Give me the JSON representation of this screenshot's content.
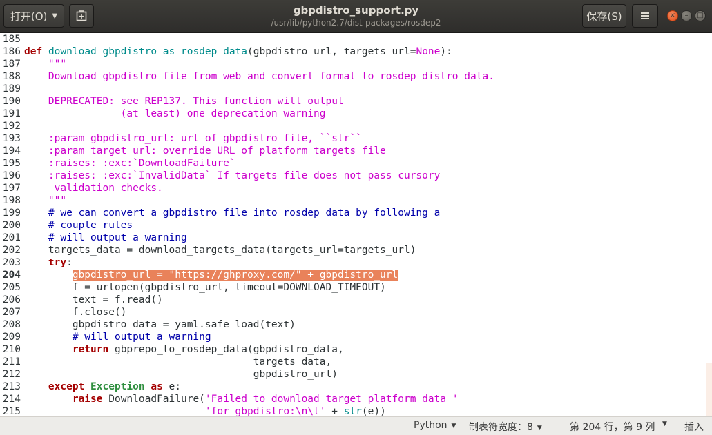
{
  "header": {
    "open_label": "打开(O)",
    "save_label": "保存(S)",
    "title": "gbpdistro_support.py",
    "subtitle": "/usr/lib/python2.7/dist-packages/rosdep2"
  },
  "editor": {
    "current_line": 204,
    "lines": [
      {
        "n": 185,
        "t": [
          {
            "c": "txt",
            "s": ""
          }
        ]
      },
      {
        "n": 186,
        "t": [
          {
            "c": "kw",
            "s": "def"
          },
          {
            "c": "txt",
            "s": " "
          },
          {
            "c": "fn",
            "s": "download_gbpdistro_as_rosdep_data"
          },
          {
            "c": "txt",
            "s": "(gbpdistro_url, targets_url="
          },
          {
            "c": "cst",
            "s": "None"
          },
          {
            "c": "txt",
            "s": "):"
          }
        ]
      },
      {
        "n": 187,
        "t": [
          {
            "c": "txt",
            "s": "    "
          },
          {
            "c": "doc",
            "s": "\"\"\""
          }
        ]
      },
      {
        "n": 188,
        "t": [
          {
            "c": "doc",
            "s": "    Download gbpdistro file from web and convert format to rosdep distro data."
          }
        ]
      },
      {
        "n": 189,
        "t": [
          {
            "c": "txt",
            "s": ""
          }
        ]
      },
      {
        "n": 190,
        "t": [
          {
            "c": "doc",
            "s": "    DEPRECATED: see REP137. This function will output"
          }
        ]
      },
      {
        "n": 191,
        "t": [
          {
            "c": "doc",
            "s": "                (at least) one deprecation warning"
          }
        ]
      },
      {
        "n": 192,
        "t": [
          {
            "c": "txt",
            "s": ""
          }
        ]
      },
      {
        "n": 193,
        "t": [
          {
            "c": "doc",
            "s": "    :param gbpdistro_url: url of gbpdistro file, ``str``"
          }
        ]
      },
      {
        "n": 194,
        "t": [
          {
            "c": "doc",
            "s": "    :param target_url: override URL of platform targets file"
          }
        ]
      },
      {
        "n": 195,
        "t": [
          {
            "c": "doc",
            "s": "    :raises: :exc:`DownloadFailure`"
          }
        ]
      },
      {
        "n": 196,
        "t": [
          {
            "c": "doc",
            "s": "    :raises: :exc:`InvalidData` If targets file does not pass cursory"
          }
        ]
      },
      {
        "n": 197,
        "t": [
          {
            "c": "doc",
            "s": "     validation checks."
          }
        ]
      },
      {
        "n": 198,
        "t": [
          {
            "c": "doc",
            "s": "    \"\"\""
          }
        ]
      },
      {
        "n": 199,
        "t": [
          {
            "c": "com",
            "s": "    # we can convert a gbpdistro file into rosdep data by following a"
          }
        ]
      },
      {
        "n": 200,
        "t": [
          {
            "c": "com",
            "s": "    # couple rules"
          }
        ]
      },
      {
        "n": 201,
        "t": [
          {
            "c": "com",
            "s": "    # will output a warning"
          }
        ]
      },
      {
        "n": 202,
        "t": [
          {
            "c": "txt",
            "s": "    targets_data = download_targets_data(targets_url=targets_url)"
          }
        ]
      },
      {
        "n": 203,
        "t": [
          {
            "c": "txt",
            "s": "    "
          },
          {
            "c": "kw",
            "s": "try"
          },
          {
            "c": "txt",
            "s": ":"
          }
        ]
      },
      {
        "n": 204,
        "t": [
          {
            "c": "txt",
            "s": "        "
          },
          {
            "c": "sel",
            "s": "gbpdistro_url = \"https://ghproxy.com/\" + gbpdistro_url"
          }
        ]
      },
      {
        "n": 205,
        "t": [
          {
            "c": "txt",
            "s": "        f = urlopen(gbpdistro_url, timeout=DOWNLOAD_TIMEOUT)"
          }
        ]
      },
      {
        "n": 206,
        "t": [
          {
            "c": "txt",
            "s": "        text = f.read()"
          }
        ]
      },
      {
        "n": 207,
        "t": [
          {
            "c": "txt",
            "s": "        f.close()"
          }
        ]
      },
      {
        "n": 208,
        "t": [
          {
            "c": "txt",
            "s": "        gbpdistro_data = yaml.safe_load(text)"
          }
        ]
      },
      {
        "n": 209,
        "t": [
          {
            "c": "com",
            "s": "        # will output a warning"
          }
        ]
      },
      {
        "n": 210,
        "t": [
          {
            "c": "txt",
            "s": "        "
          },
          {
            "c": "kw",
            "s": "return"
          },
          {
            "c": "txt",
            "s": " gbprepo_to_rosdep_data(gbpdistro_data,"
          }
        ]
      },
      {
        "n": 211,
        "t": [
          {
            "c": "txt",
            "s": "                                      targets_data,"
          }
        ]
      },
      {
        "n": 212,
        "t": [
          {
            "c": "txt",
            "s": "                                      gbpdistro_url)"
          }
        ]
      },
      {
        "n": 213,
        "t": [
          {
            "c": "txt",
            "s": "    "
          },
          {
            "c": "kw",
            "s": "except"
          },
          {
            "c": "txt",
            "s": " "
          },
          {
            "c": "bi",
            "s": "Exception"
          },
          {
            "c": "txt",
            "s": " "
          },
          {
            "c": "kw",
            "s": "as"
          },
          {
            "c": "txt",
            "s": " e:"
          }
        ]
      },
      {
        "n": 214,
        "t": [
          {
            "c": "txt",
            "s": "        "
          },
          {
            "c": "kw",
            "s": "raise"
          },
          {
            "c": "txt",
            "s": " DownloadFailure("
          },
          {
            "c": "str",
            "s": "'Failed to download target platform data '"
          }
        ]
      },
      {
        "n": 215,
        "t": [
          {
            "c": "txt",
            "s": "                              "
          },
          {
            "c": "str",
            "s": "'for gbpdistro:\\n\\t'"
          },
          {
            "c": "txt",
            "s": " + "
          },
          {
            "c": "fn",
            "s": "str"
          },
          {
            "c": "txt",
            "s": "(e))"
          }
        ]
      }
    ]
  },
  "statusbar": {
    "language": "Python",
    "tab_width": "制表符宽度：8",
    "position": "第 204 行，第 9 列",
    "insert_mode": "插入"
  },
  "colors": {
    "keyword": "#a40000",
    "function": "#008b8b",
    "docstring": "#cc00cc",
    "comment": "#0000aa",
    "builtin": "#2f8f3f",
    "selection": "#e9825a",
    "close_button": "#df4a16"
  },
  "icons": {
    "open_dropdown": "chevron-down-icon",
    "new_tab": "new-document-icon",
    "menu": "hamburger-menu-icon",
    "close": "close-icon",
    "minimize": "minimize-icon",
    "maximize": "maximize-icon"
  }
}
